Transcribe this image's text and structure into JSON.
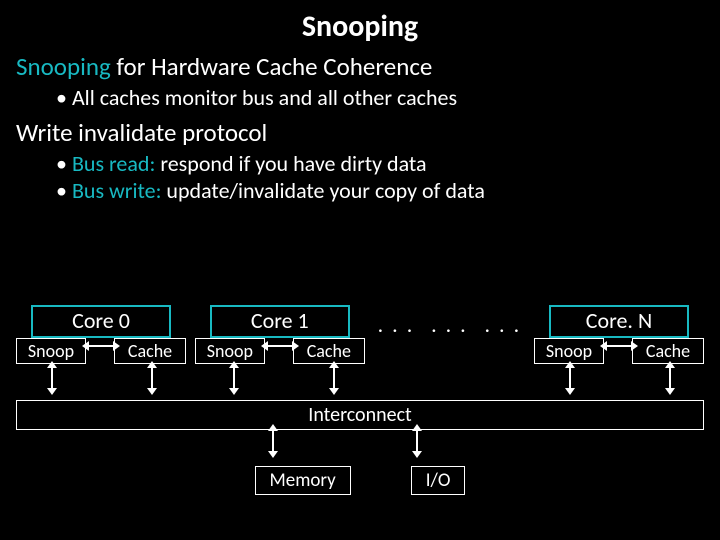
{
  "title": "Snooping",
  "sections": [
    {
      "heading_hl": "Snooping",
      "heading_rest": " for Hardware Cache Coherence",
      "bullets": [
        {
          "text": "All caches monitor bus and all other caches"
        }
      ]
    },
    {
      "heading_hl": "",
      "heading_rest": "Write invalidate protocol",
      "bullets": [
        {
          "term": "Bus read:",
          "rest": " respond if you have dirty data"
        },
        {
          "term": "Bus write:",
          "rest": " update/invalidate your copy of data"
        }
      ]
    }
  ],
  "diagram": {
    "cores": [
      {
        "label": "Core 0",
        "snoop": "Snoop",
        "cache": "Cache"
      },
      {
        "label": "Core 1",
        "snoop": "Snoop",
        "cache": "Cache"
      },
      {
        "label": "Core. N",
        "snoop": "Snoop",
        "cache": "Cache"
      }
    ],
    "dots": ". . .",
    "interconnect": "Interconnect",
    "memory": "Memory",
    "io": "I/O"
  }
}
